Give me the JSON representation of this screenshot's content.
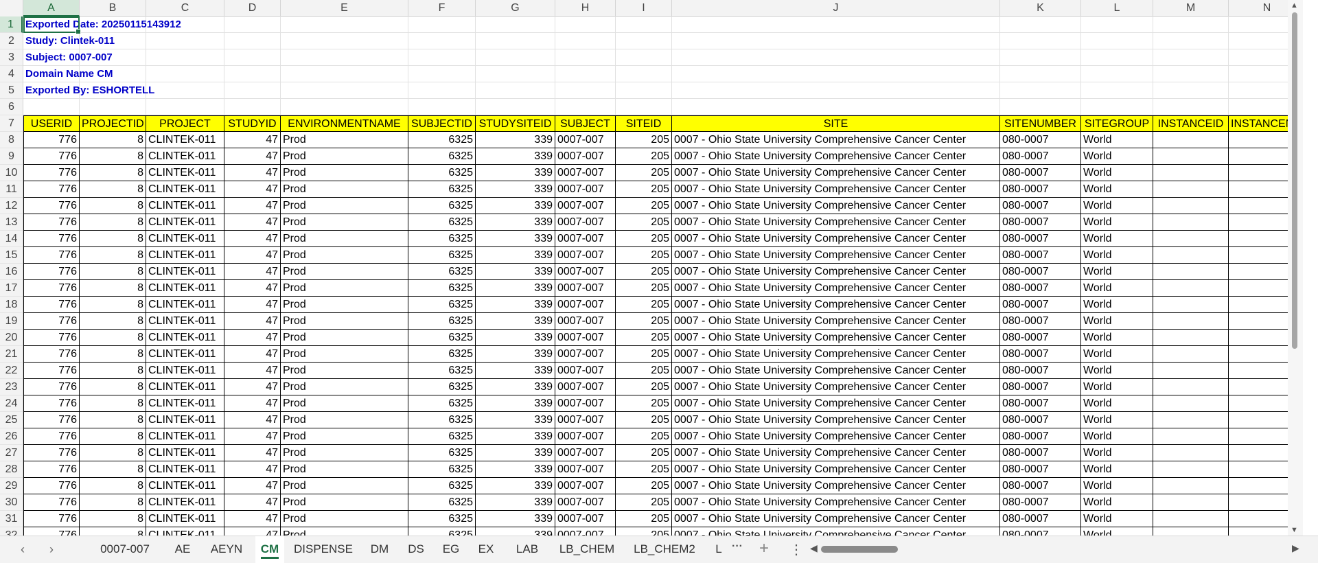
{
  "columns": [
    "A",
    "B",
    "C",
    "D",
    "E",
    "F",
    "G",
    "H",
    "I",
    "J",
    "K",
    "L",
    "M",
    "N"
  ],
  "selected_column": "A",
  "row_numbers": [
    "1",
    "2",
    "3",
    "4",
    "5",
    "6",
    "7",
    "8",
    "9",
    "10",
    "11",
    "12",
    "13",
    "14",
    "15",
    "16",
    "17",
    "18",
    "19",
    "20",
    "21",
    "22",
    "23",
    "24",
    "25",
    "26",
    "27",
    "28",
    "29",
    "30",
    "31",
    "32"
  ],
  "selected_row": "1",
  "meta_lines": [
    "Exported Date: 20250115143912",
    "Study: Clintek-011",
    "Subject: 0007-007",
    "Domain Name CM",
    "Exported By: ESHORTELL"
  ],
  "table_headers": [
    "USERID",
    "PROJECTID",
    "PROJECT",
    "STUDYID",
    "ENVIRONMENTNAME",
    "SUBJECTID",
    "STUDYSITEID",
    "SUBJECT",
    "SITEID",
    "SITE",
    "SITENUMBER",
    "SITEGROUP",
    "INSTANCEID",
    "INSTANCENAME"
  ],
  "row_template": {
    "userid": "776",
    "projectid": "8",
    "project": "CLINTEK-011",
    "studyid": "47",
    "environment": "Prod",
    "subjectid": "6325",
    "studysiteid": "339",
    "subject": "0007-007",
    "siteid": "205",
    "site": "0007 - Ohio State University Comprehensive Cancer Center",
    "sitenumber": "080-0007",
    "sitegroup": "World",
    "instanceid": "",
    "instancename": ""
  },
  "data_rows_count_visible": 25,
  "sheet_tabs": [
    "0007-007",
    "AE",
    "AEYN",
    "CM",
    "DISPENSE",
    "DM",
    "DS",
    "EG",
    "EX",
    "LAB",
    "LB_CHEM",
    "LB_CHEM2",
    "L"
  ],
  "active_tab": "CM",
  "tab_controls": {
    "prev": "‹",
    "next": "›",
    "more": "···",
    "add": "+",
    "menu": "⋮"
  },
  "colors": {
    "meta_text": "#0000C8",
    "header_fill": "#FFFF00",
    "accent": "#1E7145"
  }
}
